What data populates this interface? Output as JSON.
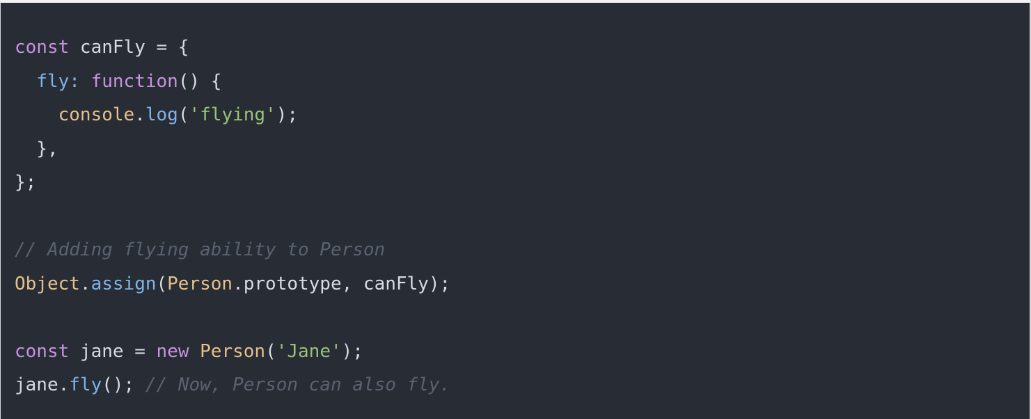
{
  "code_lines": [
    [
      {
        "t": "const",
        "c": "kw"
      },
      {
        "t": " canFly ",
        "c": "plain"
      },
      {
        "t": "=",
        "c": "pun"
      },
      {
        "t": " {",
        "c": "pun"
      }
    ],
    [
      {
        "t": "  ",
        "c": "plain"
      },
      {
        "t": "fly",
        "c": "prop"
      },
      {
        "t": ": ",
        "c": "prop"
      },
      {
        "t": "function",
        "c": "kw"
      },
      {
        "t": "() {",
        "c": "pun"
      }
    ],
    [
      {
        "t": "    ",
        "c": "plain"
      },
      {
        "t": "console",
        "c": "obj"
      },
      {
        "t": ".",
        "c": "pun"
      },
      {
        "t": "log",
        "c": "fn"
      },
      {
        "t": "(",
        "c": "pun"
      },
      {
        "t": "'flying'",
        "c": "str"
      },
      {
        "t": ");",
        "c": "pun"
      }
    ],
    [
      {
        "t": "  },",
        "c": "pun"
      }
    ],
    [
      {
        "t": "};",
        "c": "pun"
      }
    ],
    [],
    [
      {
        "t": "// Adding flying ability to Person",
        "c": "cmt"
      }
    ],
    [
      {
        "t": "Object",
        "c": "obj"
      },
      {
        "t": ".",
        "c": "pun"
      },
      {
        "t": "assign",
        "c": "fn"
      },
      {
        "t": "(",
        "c": "pun"
      },
      {
        "t": "Person",
        "c": "obj"
      },
      {
        "t": ".prototype, canFly);",
        "c": "plain"
      }
    ],
    [],
    [
      {
        "t": "const",
        "c": "kw"
      },
      {
        "t": " jane ",
        "c": "plain"
      },
      {
        "t": "=",
        "c": "pun"
      },
      {
        "t": " ",
        "c": "plain"
      },
      {
        "t": "new",
        "c": "kw"
      },
      {
        "t": " ",
        "c": "plain"
      },
      {
        "t": "Person",
        "c": "obj"
      },
      {
        "t": "(",
        "c": "pun"
      },
      {
        "t": "'Jane'",
        "c": "str"
      },
      {
        "t": ");",
        "c": "pun"
      }
    ],
    [
      {
        "t": "jane",
        "c": "plain"
      },
      {
        "t": ".",
        "c": "pun"
      },
      {
        "t": "fly",
        "c": "fn"
      },
      {
        "t": "(); ",
        "c": "pun"
      },
      {
        "t": "// Now, Person can also fly.",
        "c": "cmt"
      }
    ]
  ]
}
